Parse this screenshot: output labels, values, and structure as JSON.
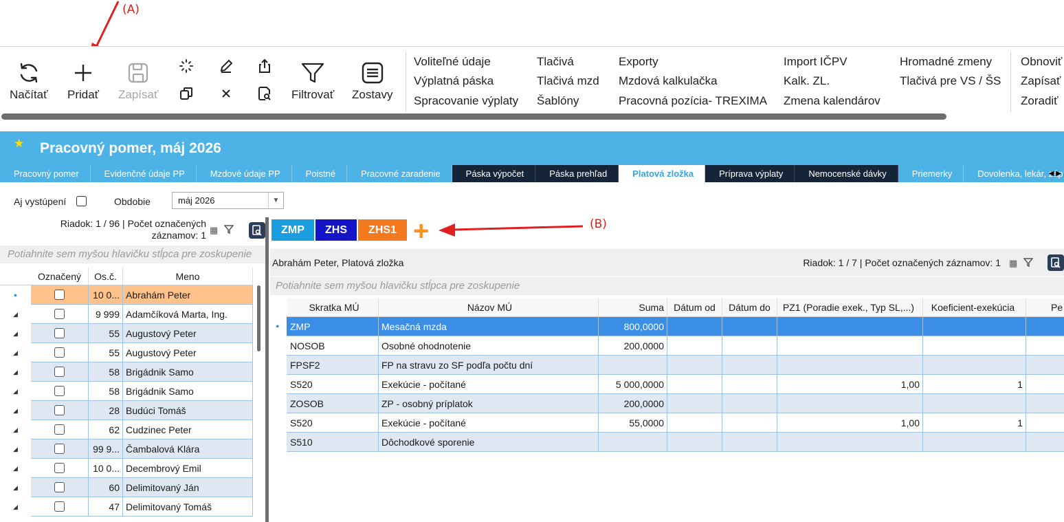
{
  "annotations": {
    "a": "(A)",
    "b": "(B)"
  },
  "ribbon": {
    "buttons": {
      "nacitat": "Načítať",
      "pridat": "Pridať",
      "zapisat": "Zapísať",
      "filtrovat": "Filtrovať",
      "zostavy": "Zostavy"
    },
    "links": {
      "col1": [
        "Voliteľné údaje",
        "Výplatná páska",
        "Spracovanie výplaty"
      ],
      "col2": [
        "Tlačivá",
        "Tlačivá mzd",
        "Šablóny"
      ],
      "col3": [
        "Exporty",
        "Mzdová kalkulačka",
        "Pracovná pozícia- TREXIMA"
      ],
      "col4": [
        "Import IČPV",
        "Kalk. ZL.",
        "Zmena kalendárov"
      ],
      "col5": [
        "Hromadné zmeny",
        "Tlačivá pre VS / ŠS"
      ],
      "col6": [
        "Obnoviť",
        "Zapísať",
        "Zoradiť"
      ]
    }
  },
  "header": {
    "title": "Pracovný pomer, máj 2026",
    "tabs": [
      "Pracovný pomer",
      "Evidenčné údaje PP",
      "Mzdové údaje PP",
      "Poistné",
      "Pracovné zaradenie",
      "Páska výpočet",
      "Páska prehľad",
      "Platová zložka",
      "Príprava výplaty",
      "Nemocenské dávky",
      "Priemerky",
      "Dovolenka, lekár, záp"
    ]
  },
  "filters": {
    "aj_vystupeni": "Aj vystúpení",
    "obdobie_label": "Obdobie",
    "obdobie_value": "máj 2026"
  },
  "left": {
    "info_line1": "Riadok: 1 / 96 | Počet označených",
    "info_line2": "záznamov: 1",
    "group_hint": "Potiahnite sem myšou hlavičku stĺpca pre zoskupenie",
    "columns": {
      "oznaceny": "Označený",
      "osc": "Os.č.",
      "meno": "Meno"
    },
    "rows": [
      {
        "osc": "10 0...",
        "meno": "Abrahám Peter"
      },
      {
        "osc": "9 999",
        "meno": "Adamčíková Marta, Ing."
      },
      {
        "osc": "55",
        "meno": "Augustový Peter"
      },
      {
        "osc": "55",
        "meno": "Augustový Peter"
      },
      {
        "osc": "58",
        "meno": "Brigádnik Samo"
      },
      {
        "osc": "58",
        "meno": "Brigádnik Samo"
      },
      {
        "osc": "28",
        "meno": "Budúci Tomáš"
      },
      {
        "osc": "62",
        "meno": "Cudzinec Peter"
      },
      {
        "osc": "99 9...",
        "meno": "Čambalová Klára"
      },
      {
        "osc": "10 0...",
        "meno": "Decembrový Emil"
      },
      {
        "osc": "60",
        "meno": "Delimitovaný Ján"
      },
      {
        "osc": "47",
        "meno": "Delimitovaný Tomáš"
      }
    ]
  },
  "right": {
    "chips": [
      {
        "label": "ZMP",
        "color": "#1a9ee0"
      },
      {
        "label": "ZHS",
        "color": "#1515c8"
      },
      {
        "label": "ZHS1",
        "color": "#f47a20"
      }
    ],
    "add_symbol": "+",
    "title": "Abrahám Peter, Platová zložka",
    "info": "Riadok: 1 / 7 | Počet označených záznamov: 1",
    "group_hint": "Potiahnite sem myšou hlavičku stĺpca pre zoskupenie",
    "columns": {
      "skratka": "Skratka MÚ",
      "nazov": "Názov MÚ",
      "suma": "Suma",
      "datum_od": "Dátum od",
      "datum_do": "Dátum do",
      "pz1": "PZ1 (Poradie exek., Typ SL,...)",
      "koef": "Koeficient-exekúcia",
      "pe": "Pe"
    },
    "rows": [
      {
        "skratka": "ZMP",
        "nazov": "Mesačná mzda",
        "suma": "800,0000",
        "pz1": "",
        "koef": ""
      },
      {
        "skratka": "NOSOB",
        "nazov": "Osobné ohodnotenie",
        "suma": "200,0000",
        "pz1": "",
        "koef": ""
      },
      {
        "skratka": "FPSF2",
        "nazov": "FP na stravu zo SF podľa počtu dní",
        "suma": "",
        "pz1": "",
        "koef": ""
      },
      {
        "skratka": "S520",
        "nazov": "Exekúcie - počítané",
        "suma": "5 000,0000",
        "pz1": "1,00",
        "koef": "1"
      },
      {
        "skratka": "ZOSOB",
        "nazov": "ZP - osobný príplatok",
        "suma": "200,0000",
        "pz1": "",
        "koef": ""
      },
      {
        "skratka": "S520",
        "nazov": "Exekúcie - počítané",
        "suma": "55,0000",
        "pz1": "1,00",
        "koef": "1"
      },
      {
        "skratka": "S510",
        "nazov": "Dôchodkové sporenie",
        "suma": "",
        "pz1": "",
        "koef": ""
      }
    ]
  }
}
